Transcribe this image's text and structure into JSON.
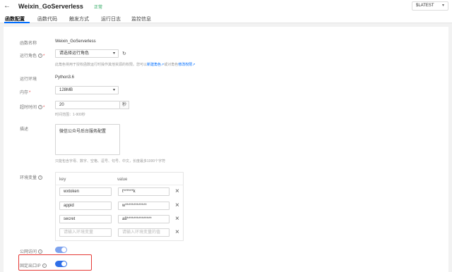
{
  "header": {
    "back_icon": "arrow-left-icon",
    "title": "Weixin_GoServerless",
    "status": "正常",
    "version_select": "$LATEST"
  },
  "tabs": [
    {
      "label": "函数配置",
      "active": true
    },
    {
      "label": "函数代码",
      "active": false
    },
    {
      "label": "触发方式",
      "active": false
    },
    {
      "label": "运行日志",
      "active": false
    },
    {
      "label": "监控信息",
      "active": false
    }
  ],
  "form": {
    "function_name": {
      "label": "函数名称",
      "value": "Weixin_GoServerless"
    },
    "role": {
      "label": "运行角色",
      "selected": "请选择运行角色",
      "hint": "此角色将用于授权函数运行时操作其他资源的权限。您可以",
      "hint_link1": "新建角色",
      "hint_mid": "或对角色",
      "hint_link2": "修改权限"
    },
    "runtime": {
      "label": "运行环境",
      "value": "Python3.6"
    },
    "memory": {
      "label": "内存",
      "selected": "128MB"
    },
    "timeout": {
      "label": "超时时间",
      "value": "20",
      "unit": "秒",
      "hint": "时间范围：1-900秒"
    },
    "description": {
      "label": "描述",
      "value": "微信公众号后台服务配置",
      "hint": "只能包含字母、数字、空格、逗号、句号、中文，长度最多1000个字符"
    },
    "env": {
      "label": "环境变量",
      "col_key": "key",
      "col_value": "value",
      "rows": [
        {
          "key": "wxtoken",
          "value": "t******k"
        },
        {
          "key": "appid",
          "value": "w*************"
        },
        {
          "key": "secret",
          "value": "a8***************"
        }
      ],
      "placeholder_key": "请输入环境变量",
      "placeholder_value": "请输入环境变量的值"
    },
    "public_access": {
      "label": "公网访问",
      "enabled": true
    },
    "fixed_egress_ip": {
      "label": "固定出口IP",
      "enabled": true
    }
  }
}
